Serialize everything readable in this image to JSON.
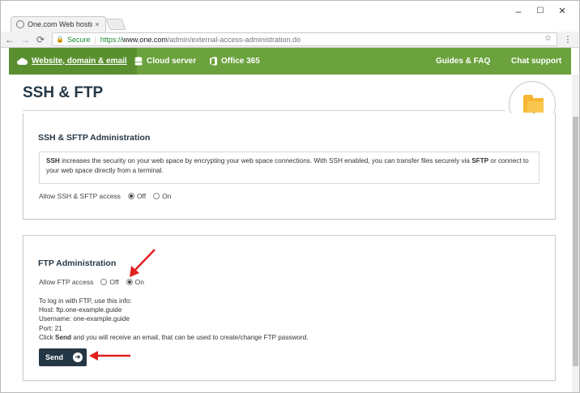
{
  "browser": {
    "tab_title": "One.com Web hosting",
    "tab_close": "×",
    "window_controls": {
      "minimize": "–",
      "maximize": "☐",
      "close": "✕"
    },
    "nav": {
      "back": "←",
      "forward": "→",
      "reload": "⟳"
    },
    "address": {
      "secure_label": "Secure",
      "scheme": "https://",
      "host": "www.one.com",
      "path": "/admin/external-access-administration.do"
    },
    "star_icon": "☆",
    "menu_icon": "⋮"
  },
  "topnav": {
    "items": [
      {
        "label": "Website, domain & email",
        "icon": "cloud-icon"
      },
      {
        "label": "Cloud server",
        "icon": "database-icon"
      },
      {
        "label": "Office 365",
        "icon": "office-icon"
      }
    ],
    "right": [
      {
        "label": "Guides & FAQ"
      },
      {
        "label": "Chat support"
      }
    ]
  },
  "page": {
    "title": "SSH & FTP",
    "icon": "folder-network-icon"
  },
  "ssh": {
    "title": "SSH & SFTP Administration",
    "info": {
      "b1": "SSH",
      "t1": " increases the security on your web space by encrypting your web space connections. With SSH enabled, you can transfer files securely via ",
      "b2": "SFTP",
      "t2": " or connect to your web space directly from a terminal."
    },
    "access_label": "Allow SSH & SFTP access",
    "off_label": "Off",
    "on_label": "On",
    "selected": "off"
  },
  "ftp": {
    "title": "FTP Administration",
    "access_label": "Allow FTP access",
    "off_label": "Off",
    "on_label": "On",
    "selected": "on",
    "info_intro": "To log in with FTP, use this info:",
    "host_line": "Host: ftp.one-example.guide",
    "username_line": "Username: one-example.guide",
    "port_line": "Port: 21",
    "click_pre": "Click ",
    "click_bold": "Send",
    "click_post": " and you will receive an email, that can be used to create/change FTP password.",
    "send_label": "Send",
    "send_icon": "➔"
  },
  "colors": {
    "nav_green": "#6ba23d",
    "nav_active": "#5a8f30",
    "dark_navy": "#243746",
    "annotation_red": "#e02020"
  }
}
